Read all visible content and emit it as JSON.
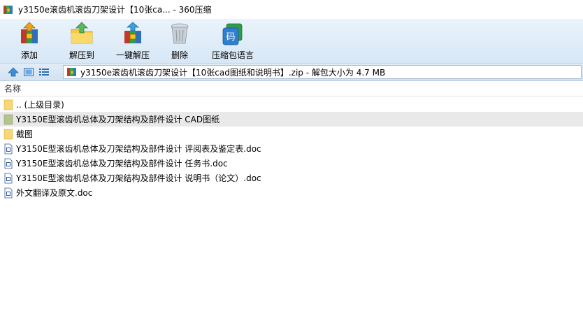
{
  "window": {
    "title": "y3150e滚齿机滚齿刀架设计【10张ca... - 360压缩"
  },
  "toolbar": {
    "buttons": [
      {
        "label": "添加",
        "icon": "add-archive-icon"
      },
      {
        "label": "解压到",
        "icon": "extract-to-icon"
      },
      {
        "label": "一键解压",
        "icon": "one-click-extract-icon"
      },
      {
        "label": "删除",
        "icon": "delete-trash-icon"
      },
      {
        "label": "压缩包语言",
        "icon": "archive-language-icon"
      }
    ],
    "language_glyph": "码"
  },
  "address": {
    "path": "y3150e滚齿机滚齿刀架设计【10张cad图纸和说明书】.zip - 解包大小为 4.7 MB"
  },
  "list": {
    "column_name": "名称",
    "items": [
      {
        "name": ".. (上级目录)",
        "type": "folder",
        "selected": false
      },
      {
        "name": "Y3150E型滚齿机总体及刀架结构及部件设计 CAD图纸",
        "type": "folder-green",
        "selected": true
      },
      {
        "name": "截图",
        "type": "folder",
        "selected": false
      },
      {
        "name": "Y3150E型滚齿机总体及刀架结构及部件设计 评阅表及鉴定表.doc",
        "type": "doc",
        "selected": false
      },
      {
        "name": "Y3150E型滚齿机总体及刀架结构及部件设计 任务书.doc",
        "type": "doc",
        "selected": false
      },
      {
        "name": "Y3150E型滚齿机总体及刀架结构及部件设计 说明书（论文）.doc",
        "type": "doc",
        "selected": false
      },
      {
        "name": "外文翻译及原文.doc",
        "type": "doc",
        "selected": false
      }
    ]
  },
  "colors": {
    "toolbar_bg": "#dfebf7",
    "selected_row": "#e9e9e9",
    "folder_yellow": "#f8d675",
    "folder_green": "#b5c48e",
    "doc_blue": "#2b5797"
  }
}
